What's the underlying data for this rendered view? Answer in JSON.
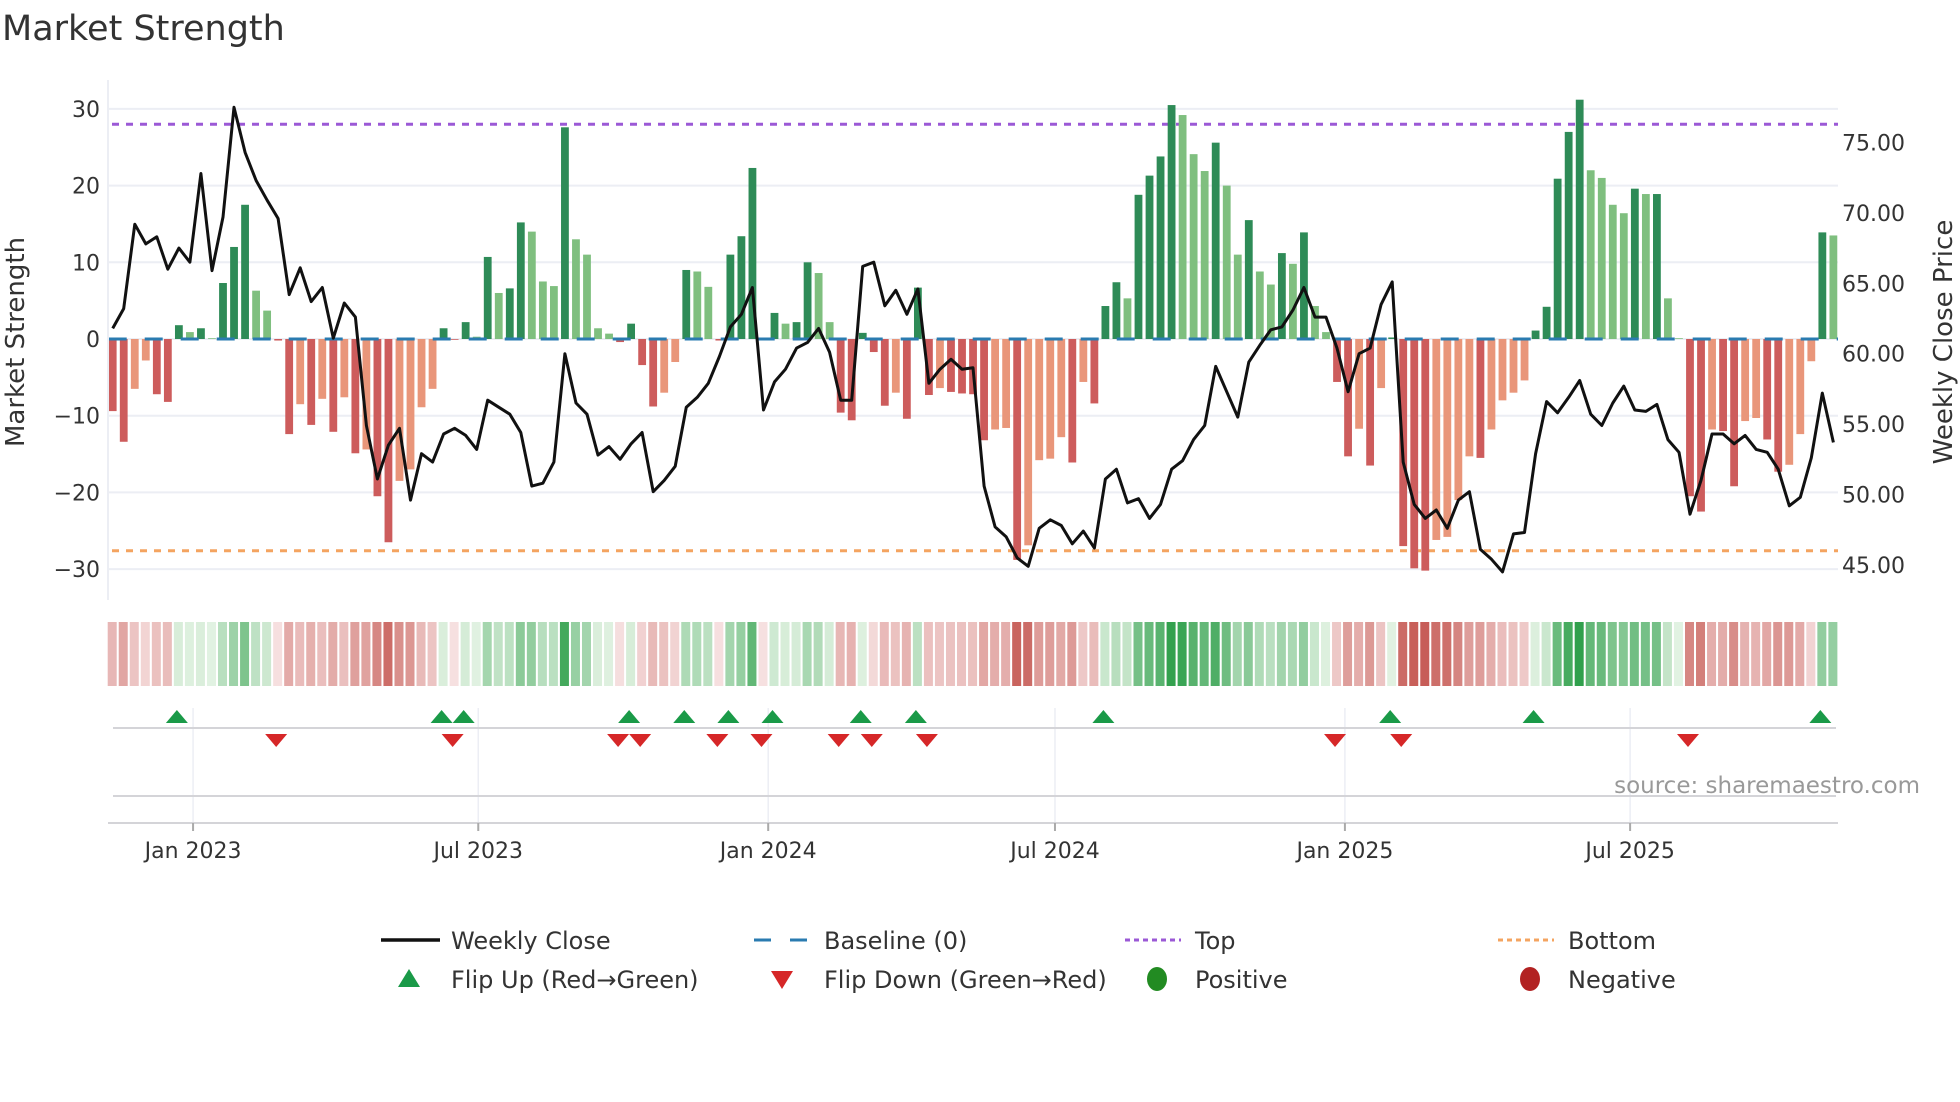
{
  "title": "Market Strength",
  "source": "source: sharemaestro.com",
  "chart_data": {
    "type": "bar",
    "title": "Market Strength",
    "start_date": "2022-11-11",
    "frequency": "weekly",
    "ylabel": "Market Strength",
    "y2label": "Weekly Close Price",
    "ylim": [
      -34,
      33
    ],
    "y2lim": [
      42.5,
      78.7
    ],
    "top_level": 28,
    "bottom_level": -27.6,
    "baseline": 0,
    "yticks": [
      {
        "v": 30,
        "label": "30"
      },
      {
        "v": 20,
        "label": "20"
      },
      {
        "v": 10,
        "label": "10"
      },
      {
        "v": 0,
        "label": "0"
      },
      {
        "v": -10,
        "label": "−10"
      },
      {
        "v": -20,
        "label": "−20"
      },
      {
        "v": -30,
        "label": "−30"
      }
    ],
    "y2ticks": [
      {
        "v": 75,
        "label": "75.00"
      },
      {
        "v": 70,
        "label": "70.00"
      },
      {
        "v": 65,
        "label": "65.00"
      },
      {
        "v": 60,
        "label": "60.00"
      },
      {
        "v": 55,
        "label": "55.00"
      },
      {
        "v": 50,
        "label": "50.00"
      },
      {
        "v": 45,
        "label": "45.00"
      }
    ],
    "xticks": [
      {
        "date": "2023-01-01",
        "label": "Jan 2023"
      },
      {
        "date": "2023-07-01",
        "label": "Jul 2023"
      },
      {
        "date": "2024-01-01",
        "label": "Jan 2024"
      },
      {
        "date": "2024-07-01",
        "label": "Jul 2024"
      },
      {
        "date": "2025-01-01",
        "label": "Jan 2025"
      },
      {
        "date": "2025-07-01",
        "label": "Jul 2025"
      }
    ],
    "strength": [
      -9.4,
      -13.4,
      -6.5,
      -2.8,
      -7.2,
      -8.2,
      1.8,
      0.9,
      1.4,
      0.1,
      7.3,
      12,
      17.5,
      6.3,
      3.7,
      -0.2,
      -12.4,
      -8.5,
      -11.2,
      -7.8,
      -12.1,
      -7.6,
      -14.9,
      -14.4,
      -20.5,
      -26.5,
      -18.5,
      -17,
      -8.9,
      -6.5,
      1.4,
      -0.1,
      2.2,
      0.3,
      10.7,
      6,
      6.6,
      15.2,
      14,
      7.5,
      6.9,
      27.6,
      13,
      11,
      1.4,
      0.7,
      -0.4,
      2,
      -3.4,
      -8.8,
      -7,
      -3,
      9,
      8.8,
      6.8,
      -0.2,
      11,
      13.4,
      22.3,
      -0.1,
      3.4,
      2,
      2.2,
      10,
      8.6,
      2.2,
      -9.6,
      -10.6,
      0.8,
      -1.7,
      -8.7,
      -7,
      -10.4,
      6.7,
      -7.3,
      -6.4,
      -6.9,
      -7.1,
      -7.2,
      -13.2,
      -11.8,
      -11.6,
      -28.8,
      -26.9,
      -15.8,
      -15.6,
      -12.8,
      -16.1,
      -5.6,
      -8.4,
      4.3,
      7.4,
      5.3,
      18.8,
      21.3,
      23.8,
      30.5,
      29.2,
      24.1,
      21.9,
      25.6,
      20,
      11,
      15.5,
      8.8,
      7.1,
      11.2,
      9.8,
      13.9,
      4.3,
      0.9,
      -5.6,
      -15.3,
      -11.7,
      -16.5,
      -6.4,
      0.2,
      -27,
      -29.9,
      -30.2,
      -26.2,
      -25.8,
      -21,
      -15.3,
      -15.5,
      -11.8,
      -8,
      -7,
      -5.4,
      1.1,
      4.2,
      20.9,
      27,
      31.2,
      22,
      21,
      17.5,
      16.4,
      19.6,
      18.9,
      18.9,
      5.3,
      0.1,
      -20.5,
      -22.5,
      -11.8,
      -12,
      -19.2,
      -10.7,
      -10.3,
      -13.1,
      -17.3,
      -16.4,
      -12.4,
      -2.9,
      13.9,
      13.5
    ],
    "close": [
      61.8,
      63.2,
      69.2,
      67.8,
      68.3,
      66.0,
      67.5,
      66.5,
      72.8,
      65.9,
      69.7,
      77.5,
      74.3,
      72.3,
      70.9,
      69.6,
      64.2,
      66.1,
      63.7,
      64.7,
      61.1,
      63.6,
      62.6,
      54.9,
      51.1,
      53.5,
      54.7,
      49.6,
      52.9,
      52.3,
      54.3,
      54.7,
      54.2,
      53.2,
      56.7,
      56.2,
      55.7,
      54.4,
      50.6,
      50.8,
      52.3,
      60.0,
      56.5,
      55.7,
      52.8,
      53.4,
      52.5,
      53.6,
      54.4,
      50.2,
      51.0,
      52.0,
      56.2,
      56.9,
      57.9,
      59.8,
      61.9,
      62.8,
      64.7,
      56.0,
      58.0,
      58.9,
      60.4,
      60.8,
      61.8,
      60.1,
      56.7,
      56.7,
      66.2,
      66.5,
      63.4,
      64.5,
      62.8,
      64.6,
      57.9,
      58.9,
      59.6,
      58.9,
      59.0,
      50.6,
      47.7,
      47.0,
      45.5,
      44.9,
      47.6,
      48.2,
      47.8,
      46.5,
      47.4,
      46.2,
      51.1,
      51.8,
      49.4,
      49.7,
      48.3,
      49.3,
      51.8,
      52.4,
      53.9,
      54.9,
      59.1,
      57.3,
      55.5,
      59.4,
      60.6,
      61.7,
      61.9,
      63.1,
      64.7,
      62.6,
      62.6,
      60.4,
      57.3,
      60.0,
      60.4,
      63.5,
      65.1,
      52.3,
      49.3,
      48.3,
      48.9,
      47.6,
      49.6,
      50.2,
      46.1,
      45.4,
      44.5,
      47.2,
      47.3,
      52.9,
      56.6,
      55.8,
      56.9,
      58.1,
      55.7,
      54.9,
      56.5,
      57.7,
      56.0,
      55.9,
      56.4,
      53.9,
      53.0,
      48.6,
      51.0,
      54.3,
      54.3,
      53.6,
      54.2,
      53.2,
      53.0,
      51.8,
      49.2,
      49.8,
      52.6,
      57.2,
      53.7
    ],
    "colors": {
      "green_strong": "#2e8b57",
      "green_weak": "#7fbf7f",
      "red_strong": "#cd5c5c",
      "red_weak": "#e9967a",
      "baseline": "#2a7bb0",
      "top": "#9b59d6",
      "bottom": "#f4a460",
      "close": "#111111",
      "flip_up": "#1a9a48",
      "flip_down": "#d62728",
      "positive": "#228b22",
      "negative": "#b22222"
    },
    "legend": [
      {
        "key": "close",
        "label": "Weekly Close"
      },
      {
        "key": "baseline",
        "label": "Baseline (0)"
      },
      {
        "key": "top",
        "label": "Top"
      },
      {
        "key": "bottom",
        "label": "Bottom"
      },
      {
        "key": "flip_up",
        "label": "Flip Up (Red→Green)"
      },
      {
        "key": "flip_down",
        "label": "Flip Down (Green→Red)"
      },
      {
        "key": "positive",
        "label": "Positive"
      },
      {
        "key": "negative",
        "label": "Negative"
      }
    ],
    "legend_position": "bottom"
  }
}
